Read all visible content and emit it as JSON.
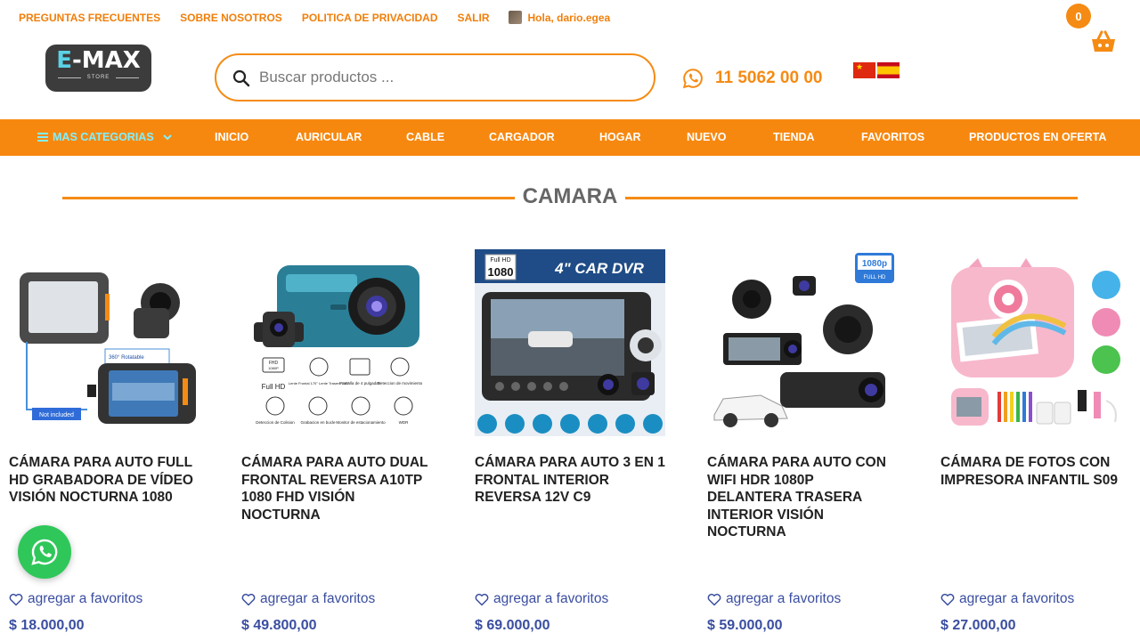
{
  "topbar": {
    "links": [
      "PREGUNTAS FRECUENTES",
      "SOBRE NOSOTROS",
      "POLITICA DE PRIVACIDAD",
      "SALIR"
    ],
    "greeting": "Hola, dario.egea"
  },
  "cart": {
    "count": "0",
    "icon": "basket-icon"
  },
  "logo": {
    "main_e": "E",
    "main_rest": "-MAX",
    "sub": "STORE"
  },
  "search": {
    "placeholder": "Buscar productos ...",
    "value": ""
  },
  "phone": {
    "number": "11 5062 00 00",
    "icon": "whatsapp-icon"
  },
  "languages": [
    "Chinese",
    "Spanish"
  ],
  "nav": {
    "categories_label": "MAS CATEGORIAS",
    "items": [
      "INICIO",
      "AURICULAR",
      "CABLE",
      "CARGADOR",
      "HOGAR",
      "NUEVO",
      "TIENDA",
      "FAVORITOS",
      "PRODUCTOS EN OFERTA"
    ]
  },
  "section": {
    "title": "CAMARA"
  },
  "products": [
    {
      "name": "Cámara Para Auto Full HD Grabadora De Vídeo Visión Nocturna 1080",
      "fav_label": "agregar a favoritos",
      "price": "$ 18.000,00"
    },
    {
      "name": "Cámara Para Auto Dual Frontal Reversa A10TP 1080 FHD Visión Nocturna",
      "fav_label": "agregar a favoritos",
      "price": "$ 49.800,00"
    },
    {
      "name": "Cámara Para Auto 3 En 1 Frontal Interior Reversa 12V C9",
      "fav_label": "agregar a favoritos",
      "price": "$ 69.000,00"
    },
    {
      "name": "Cámara Para Auto Con WiFi HDR 1080P Delantera Trasera Interior Visión Nocturna",
      "fav_label": "agregar a favoritos",
      "price": "$ 59.000,00"
    },
    {
      "name": "Cámara de Fotos con Impresora Infantil S09",
      "fav_label": "agregar a favoritos",
      "price": "$ 27.000,00"
    }
  ],
  "product_images": {
    "p1": {
      "badge": "Not included",
      "rot": "360° Rotatable"
    },
    "p2": {
      "fhd": "FHD",
      "res": "1080P",
      "labels": [
        "Full HD",
        "Lente Frontal 170° Lente Trasero 130°",
        "Pantalla de 4 pulgadas",
        "Deteccion de movimiento",
        "Deteccion de Colision",
        "Grabacion en bucle",
        "Monitor de estacionamiento",
        "WDR"
      ]
    },
    "p3": {
      "badge_top": "Full HD",
      "badge_num": "1080",
      "banner": "4\" CAR DVR"
    },
    "p4": {
      "badge_top": "1080p",
      "badge_bot": "FULL HD"
    }
  },
  "colors": {
    "accent": "#f58b14",
    "nav_bg": "#f7880f",
    "price": "#3a4ea0",
    "whatsapp": "#2fc75a",
    "category_label": "#7ff0ff"
  }
}
